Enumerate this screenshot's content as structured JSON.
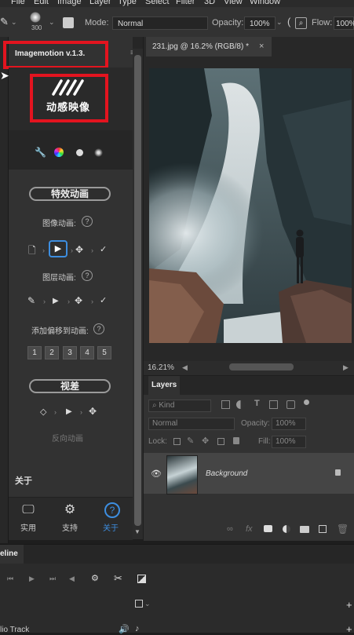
{
  "menubar": {
    "items": [
      "File",
      "Edit",
      "Image",
      "Layer",
      "Type",
      "Select",
      "Filter",
      "3D",
      "View",
      "Window"
    ]
  },
  "options": {
    "brush_size": "300",
    "mode_label": "Mode:",
    "mode_value": "Normal",
    "opacity_label": "Opacity:",
    "opacity_value": "100%",
    "flow_label": "Flow:",
    "flow_value": "100%"
  },
  "plugin": {
    "tab_title": "Imagemotion v.1.3.",
    "logo_text": "动感映像",
    "section_effects": "特效动画",
    "image_anim_label": "图像动画:",
    "layer_anim_label": "图层动画:",
    "add_offset_label": "添加偏移到动画:",
    "offset_numbers": [
      "1",
      "2",
      "3",
      "4",
      "5"
    ],
    "section_parallax": "视差",
    "reverse_anim": "反向动画",
    "about_heading": "关于",
    "nav": [
      {
        "label": "实用",
        "icon": "monitor-icon"
      },
      {
        "label": "支持",
        "icon": "gear-icon"
      },
      {
        "label": "关于",
        "icon": "question-icon"
      }
    ],
    "accent_color": "#3d8ee0",
    "highlight_color": "#e3141f"
  },
  "document": {
    "tab_title": "231.jpg @ 16.2% (RGB/8) *",
    "zoom": "16.21%"
  },
  "layers": {
    "tab": "Layers",
    "kind_label": "Kind",
    "blend_mode": "Normal",
    "opacity_label": "Opacity:",
    "opacity_value": "100%",
    "lock_label": "Lock:",
    "fill_label": "Fill:",
    "fill_value": "100%",
    "layer_name": "Background"
  },
  "timeline": {
    "tab": "eline",
    "track_label": "lio Track"
  }
}
